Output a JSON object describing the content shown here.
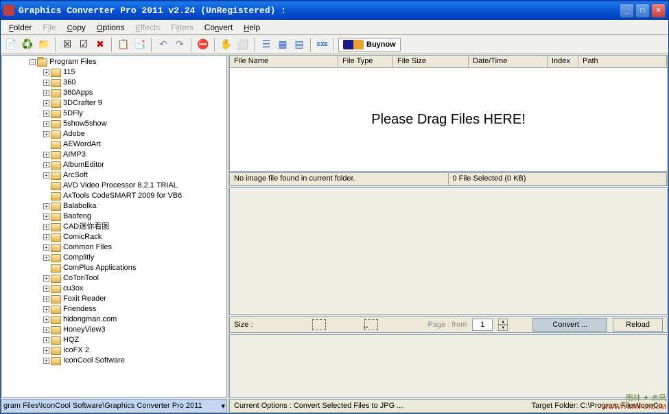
{
  "window": {
    "title": "Graphics Converter Pro 2011 v2.24 (UnRegistered) :"
  },
  "menu": {
    "folder": "Folder",
    "file": "File",
    "copy": "Copy",
    "options": "Options",
    "effects": "Effects",
    "filters": "Filters",
    "convert": "Convert",
    "help": "Help"
  },
  "toolbar": {
    "buynow": "Buynow"
  },
  "tree": {
    "root": "Program Files",
    "items": [
      {
        "label": "115",
        "expandable": true
      },
      {
        "label": "360",
        "expandable": true
      },
      {
        "label": "360Apps",
        "expandable": true
      },
      {
        "label": "3DCrafter 9",
        "expandable": true
      },
      {
        "label": "5DFly",
        "expandable": true
      },
      {
        "label": "5show5show",
        "expandable": true
      },
      {
        "label": "Adobe",
        "expandable": true
      },
      {
        "label": "AEWordArt",
        "expandable": false
      },
      {
        "label": "AIMP3",
        "expandable": true
      },
      {
        "label": "AlbumEditor",
        "expandable": true
      },
      {
        "label": "ArcSoft",
        "expandable": true
      },
      {
        "label": "AVD Video Processor 8.2.1 TRIAL",
        "expandable": false
      },
      {
        "label": "AxTools CodeSMART 2009 for VB6",
        "expandable": false
      },
      {
        "label": "Balabolka",
        "expandable": true
      },
      {
        "label": "Baofeng",
        "expandable": true
      },
      {
        "label": "CAD迷你看图",
        "expandable": true
      },
      {
        "label": "ComicRack",
        "expandable": true
      },
      {
        "label": "Common Files",
        "expandable": true
      },
      {
        "label": "Complitly",
        "expandable": true
      },
      {
        "label": "ComPlus Applications",
        "expandable": false
      },
      {
        "label": "CoTonTool",
        "expandable": true
      },
      {
        "label": "cu3ox",
        "expandable": true
      },
      {
        "label": "Foxit Reader",
        "expandable": true
      },
      {
        "label": "Friendess",
        "expandable": true
      },
      {
        "label": "hidongman.com",
        "expandable": true
      },
      {
        "label": "HoneyView3",
        "expandable": true
      },
      {
        "label": "HQZ",
        "expandable": true
      },
      {
        "label": "IcoFX 2",
        "expandable": true
      },
      {
        "label": "IconCool Software",
        "expandable": true
      }
    ]
  },
  "pathbar": {
    "path": "gram Files\\IconCool Software\\Graphics Converter Pro 2011"
  },
  "list": {
    "columns": {
      "filename": "File Name",
      "filetype": "File Type",
      "filesize": "File Size",
      "datetime": "Date/Time",
      "index": "Index",
      "path": "Path"
    },
    "dragmsg": "Please Drag Files HERE!"
  },
  "status": {
    "left": "No image file found in current folder.",
    "right": "0 File Selected (0 KB)"
  },
  "sizebar": {
    "size_label": "Size :",
    "page_label": "Page : from",
    "page_value": "1",
    "convert": "Convert ...",
    "reload": "Reload"
  },
  "footer": {
    "left": "Current Options : Convert Selected Files to JPG ...",
    "right": "Target Folder:  C:\\Program Files\\IconCo"
  },
  "watermark": {
    "line1": "雨林 ✦ 木风",
    "line2": "WwW.YLMFU.CoM"
  }
}
